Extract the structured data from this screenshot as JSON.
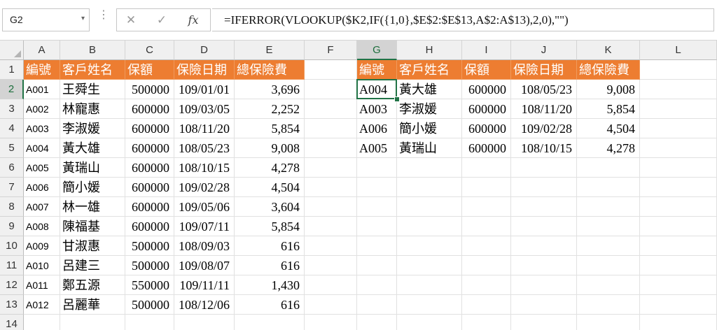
{
  "formula_bar": {
    "name_box": "G2",
    "name_box_arrow": "▾",
    "dots": "⋮",
    "cancel": "✕",
    "enter": "✓",
    "fx": "fx",
    "formula": "=IFERROR(VLOOKUP($K2,IF({1,0},$E$2:$E$13,A$2:A$13),2,0),\"\")"
  },
  "columns": [
    "A",
    "B",
    "C",
    "D",
    "E",
    "F",
    "G",
    "H",
    "I",
    "J",
    "K",
    "L"
  ],
  "rows": [
    "1",
    "2",
    "3",
    "4",
    "5",
    "6",
    "7",
    "8",
    "9",
    "10",
    "11",
    "12",
    "13",
    "14"
  ],
  "selected_column": "G",
  "selected_row": "2",
  "left_table": {
    "headers": [
      "編號",
      "客戶姓名",
      "保額",
      "保險日期",
      "總保險費"
    ],
    "rows": [
      [
        "A001",
        "王舜生",
        "500000",
        "109/01/01",
        "3,696"
      ],
      [
        "A002",
        "林寵惠",
        "600000",
        "109/03/05",
        "2,252"
      ],
      [
        "A003",
        "李淑媛",
        "600000",
        "108/11/20",
        "5,854"
      ],
      [
        "A004",
        "黃大雄",
        "600000",
        "108/05/23",
        "9,008"
      ],
      [
        "A005",
        "黃瑞山",
        "600000",
        "108/10/15",
        "4,278"
      ],
      [
        "A006",
        "簡小媛",
        "600000",
        "109/02/28",
        "4,504"
      ],
      [
        "A007",
        "林一雄",
        "600000",
        "109/05/06",
        "3,604"
      ],
      [
        "A008",
        "陳福基",
        "600000",
        "109/07/11",
        "5,854"
      ],
      [
        "A009",
        "甘淑惠",
        "500000",
        "108/09/03",
        "616"
      ],
      [
        "A010",
        "呂建三",
        "500000",
        "109/08/07",
        "616"
      ],
      [
        "A011",
        "鄭五源",
        "550000",
        "109/11/11",
        "1,430"
      ],
      [
        "A012",
        "呂麗華",
        "500000",
        "108/12/06",
        "616"
      ]
    ]
  },
  "right_table": {
    "headers": [
      "編號",
      "客戶姓名",
      "保額",
      "保險日期",
      "總保險費"
    ],
    "rows": [
      [
        "A004",
        "黃大雄",
        "600000",
        "108/05/23",
        "9,008"
      ],
      [
        "A003",
        "李淑媛",
        "600000",
        "108/11/20",
        "5,854"
      ],
      [
        "A006",
        "簡小媛",
        "600000",
        "109/02/28",
        "4,504"
      ],
      [
        "A005",
        "黃瑞山",
        "600000",
        "108/10/15",
        "4,278"
      ]
    ]
  },
  "colors": {
    "header_fill": "#ed7d31",
    "header_text": "#ffffff",
    "selection": "#217346"
  }
}
